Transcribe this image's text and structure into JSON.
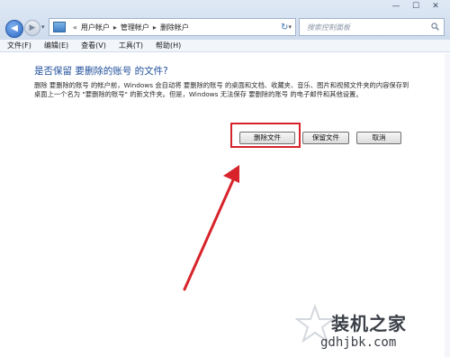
{
  "window": {
    "controls": {
      "minimize": "—",
      "maximize": "☐",
      "close": "✕"
    }
  },
  "nav": {
    "back_glyph": "◀",
    "forward_glyph": "▶",
    "history_glyph": "▾"
  },
  "address": {
    "prefix": "«",
    "crumbs": [
      "用户帐户",
      "管理帐户",
      "删除帐户"
    ],
    "separator": "▸",
    "dropdown_glyph": "▾"
  },
  "refresh_glyph": "↻",
  "search": {
    "placeholder": "搜索控制面板"
  },
  "menu": {
    "items": [
      "文件(F)",
      "编辑(E)",
      "查看(V)",
      "工具(T)",
      "帮助(H)"
    ]
  },
  "dialog": {
    "heading": "是否保留 要删除的账号 的文件?",
    "description": "删除 要删除的账号 的帐户前，Windows 会自动将 要删除的账号 的桌面和文档、收藏夹、音乐、图片和视频文件夹的内容保存到桌面上一个名为 \"要删除的账号\" 的新文件夹。但是，Windows 无法保存 要删除的账号 的电子邮件和其他设置。",
    "buttons": {
      "delete_files": "删除文件",
      "keep_files": "保留文件",
      "cancel": "取消"
    }
  },
  "annotation": {
    "color": "#d8232a"
  },
  "watermark": {
    "title": "装机之家",
    "url": "gdhjbk.com"
  }
}
